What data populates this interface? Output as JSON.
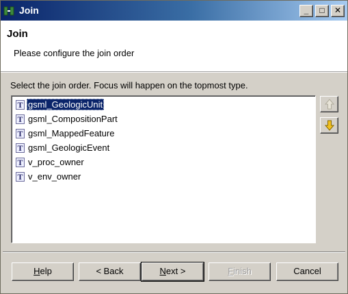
{
  "window": {
    "title": "Join",
    "minimize": "_",
    "maximize": "□",
    "close": "✕"
  },
  "header": {
    "title": "Join",
    "description": "Please configure the join order"
  },
  "instruction": "Select the join order. Focus will happen on the topmost type.",
  "list": {
    "type_icon_glyph": "T",
    "selected_index": 0,
    "items": [
      "gsml_GeologicUnit",
      "gsml_CompositionPart",
      "gsml_MappedFeature",
      "gsml_GeologicEvent",
      "v_proc_owner",
      "v_env_owner"
    ]
  },
  "side_buttons": {
    "up_icon": "up-arrow-icon",
    "down_icon": "down-arrow-icon",
    "up_enabled": false,
    "down_enabled": true
  },
  "buttons": {
    "help": "Help",
    "back": "< Back",
    "next": "Next >",
    "finish": "Finish",
    "cancel": "Cancel"
  },
  "colors": {
    "selection": "#0a246a",
    "dialog_bg": "#d4d0c8",
    "arrow_enabled": "#f0c020"
  }
}
